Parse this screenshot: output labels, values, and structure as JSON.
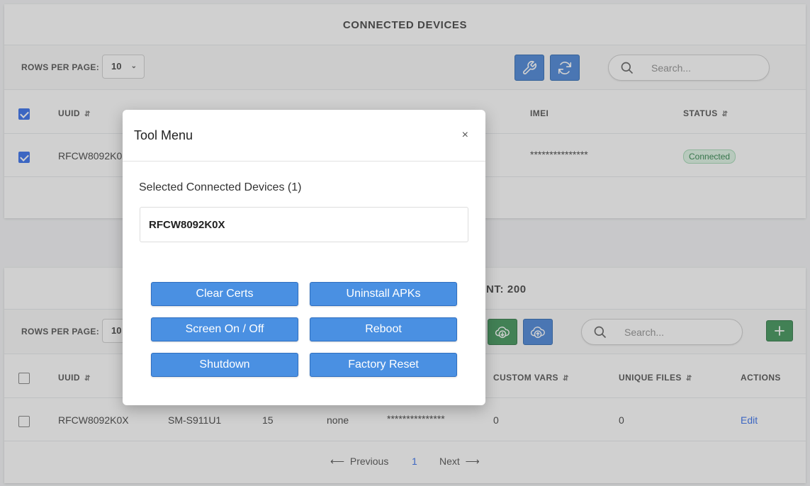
{
  "connected_devices": {
    "title": "CONNECTED DEVICES",
    "rows_per_page_label": "ROWS PER PAGE:",
    "rows_per_page_value": "10",
    "search_placeholder": "Search...",
    "columns": [
      "UUID",
      "IMEI",
      "STATUS"
    ],
    "rows": [
      {
        "uuid": "RFCW8092K0X",
        "imei": "***************",
        "status": "Connected",
        "checked": true
      }
    ]
  },
  "devices": {
    "title_fragment": "NT: 200",
    "rows_per_page_label": "ROWS PER PAGE:",
    "rows_per_page_value": "10",
    "search_placeholder": "Search...",
    "columns": [
      "UUID",
      "CUSTOM VARS",
      "UNIQUE FILES",
      "ACTIONS"
    ],
    "rows": [
      {
        "uuid": "RFCW8092K0X",
        "model": "SM-S911U1",
        "version": "15",
        "col4": "none",
        "imei": "***************",
        "custom_vars": "0",
        "unique_files": "0",
        "action": "Edit"
      }
    ],
    "pagination": {
      "prev": "Previous",
      "page": "1",
      "next": "Next"
    }
  },
  "modal": {
    "title": "Tool Menu",
    "close": "×",
    "selected_label": "Selected Connected Devices (1)",
    "selected_device": "RFCW8092K0X",
    "buttons": [
      "Clear Certs",
      "Uninstall APKs",
      "Screen On / Off",
      "Reboot",
      "Shutdown",
      "Factory Reset"
    ]
  },
  "colors": {
    "primary": "#3a7bd5",
    "success": "#2e8b4a",
    "modal_button": "#4a90e2",
    "badge_bg": "#dcf5e3"
  },
  "icons": {
    "tools": "wrench-icon",
    "refresh": "refresh-icon",
    "search": "search-icon",
    "download": "cloud-download-icon",
    "upload": "cloud-upload-icon",
    "add": "plus-icon"
  }
}
